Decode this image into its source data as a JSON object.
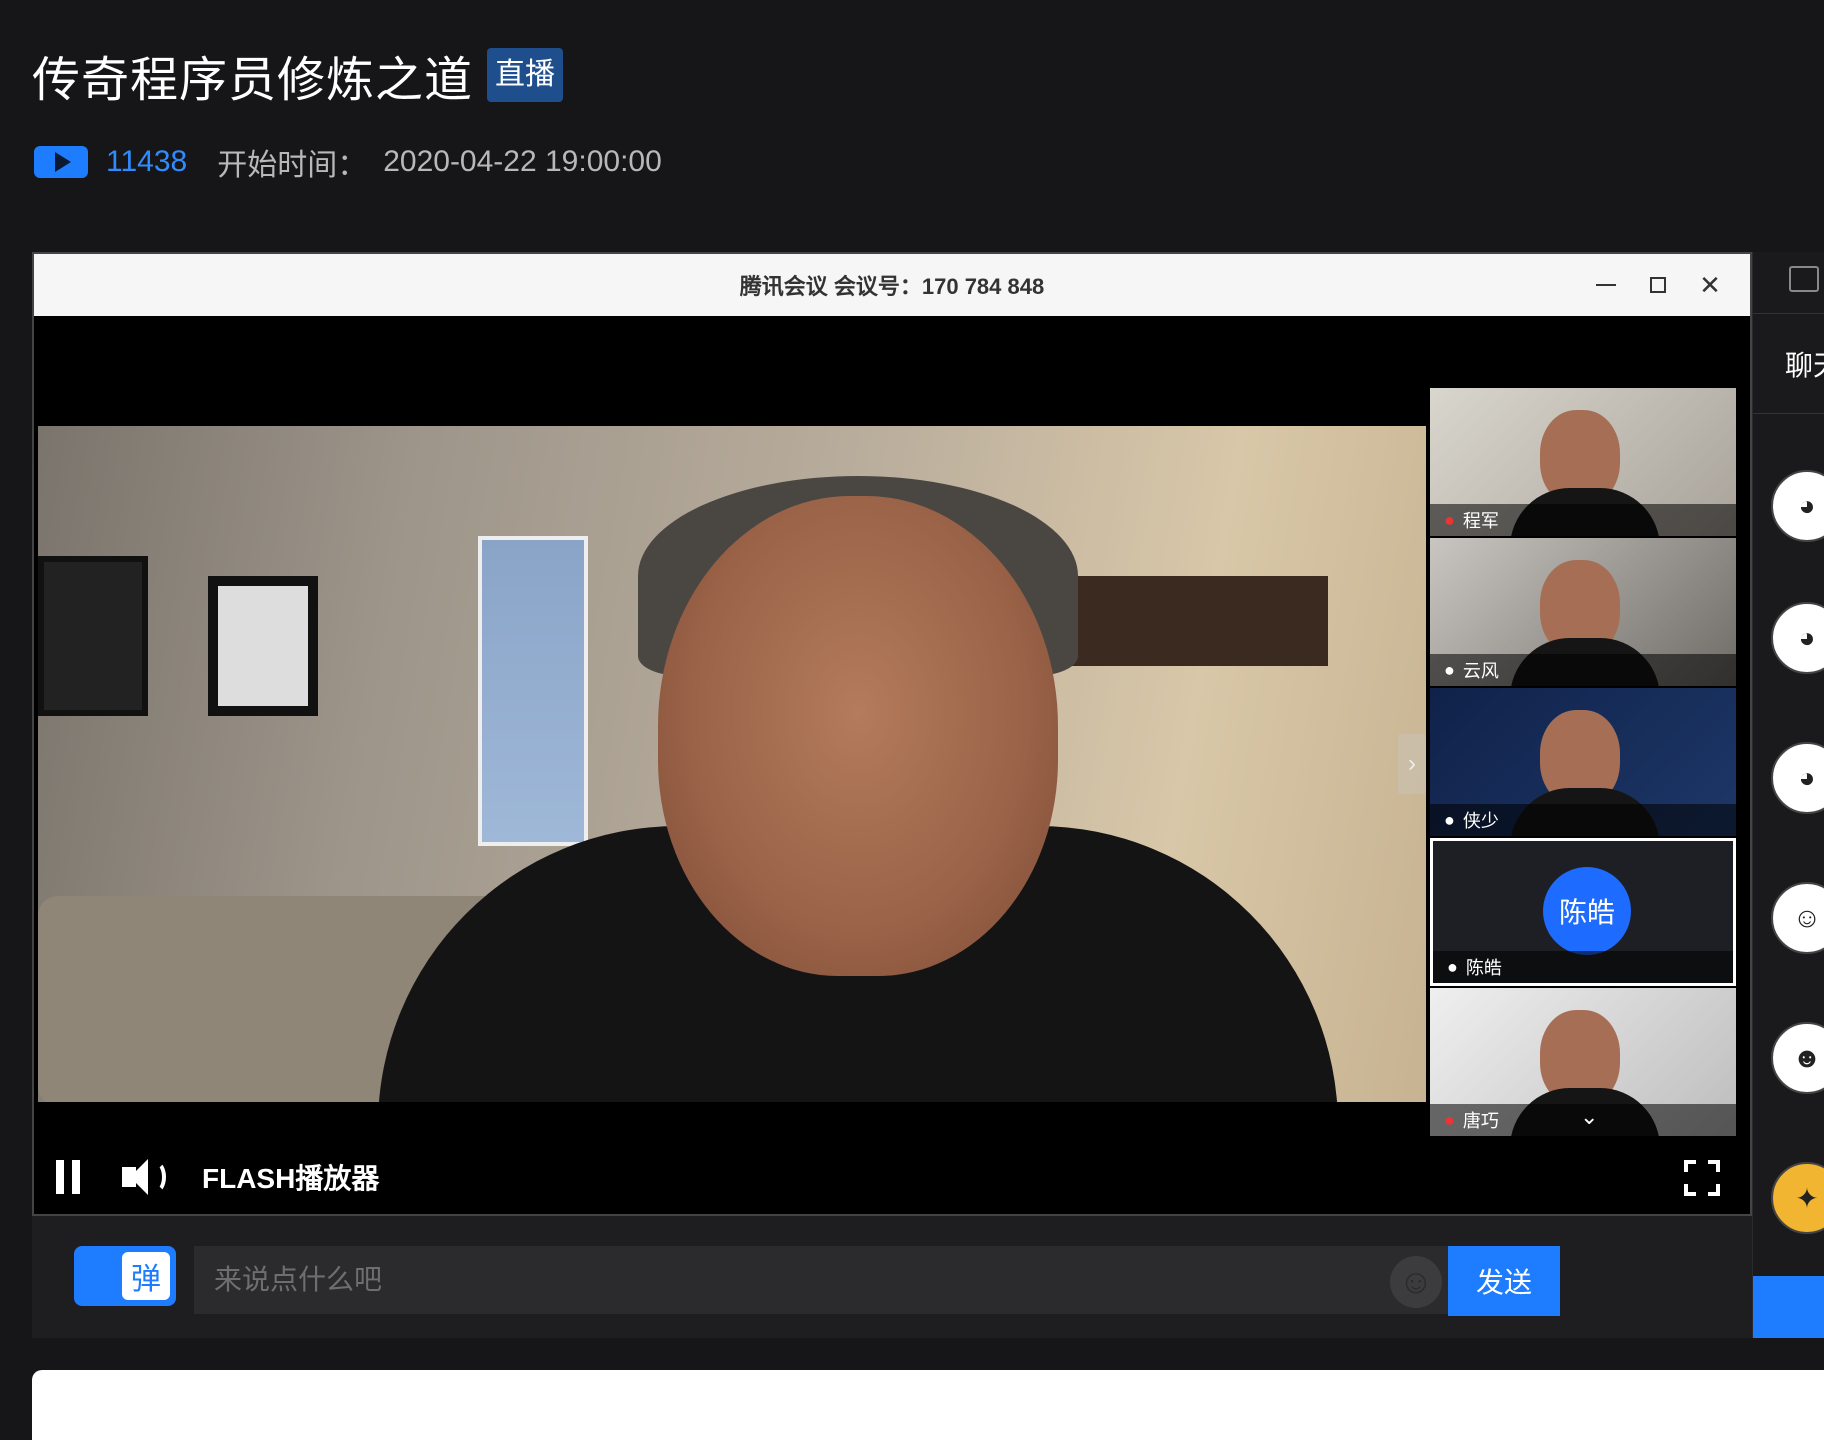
{
  "header": {
    "title": "传奇程序员修炼之道",
    "badge": "直播",
    "view_count": "11438",
    "start_label": "开始时间：",
    "start_time": "2020-04-22 19:00:00"
  },
  "meeting_window": {
    "title": "腾讯会议 会议号：170 784 848",
    "minimize_icon": "minimize-icon",
    "maximize_icon": "maximize-icon",
    "close_icon": "close-icon"
  },
  "participants": [
    {
      "name": "程军",
      "mic": "muted"
    },
    {
      "name": "云风",
      "mic": "on"
    },
    {
      "name": "侠少",
      "mic": "on"
    },
    {
      "name": "陈皓",
      "mic": "on",
      "avatar_text": "陈皓"
    },
    {
      "name": "唐巧",
      "mic": "muted"
    }
  ],
  "player": {
    "label": "FLASH播放器",
    "state": "playing"
  },
  "chat_input": {
    "danmu_label": "弹",
    "placeholder": "来说点什么吧",
    "send_label": "发送"
  },
  "sidebar": {
    "tab_label": "聊天"
  },
  "colors": {
    "accent": "#1e7cff",
    "badge": "#1f4e8c",
    "background": "#161618"
  }
}
